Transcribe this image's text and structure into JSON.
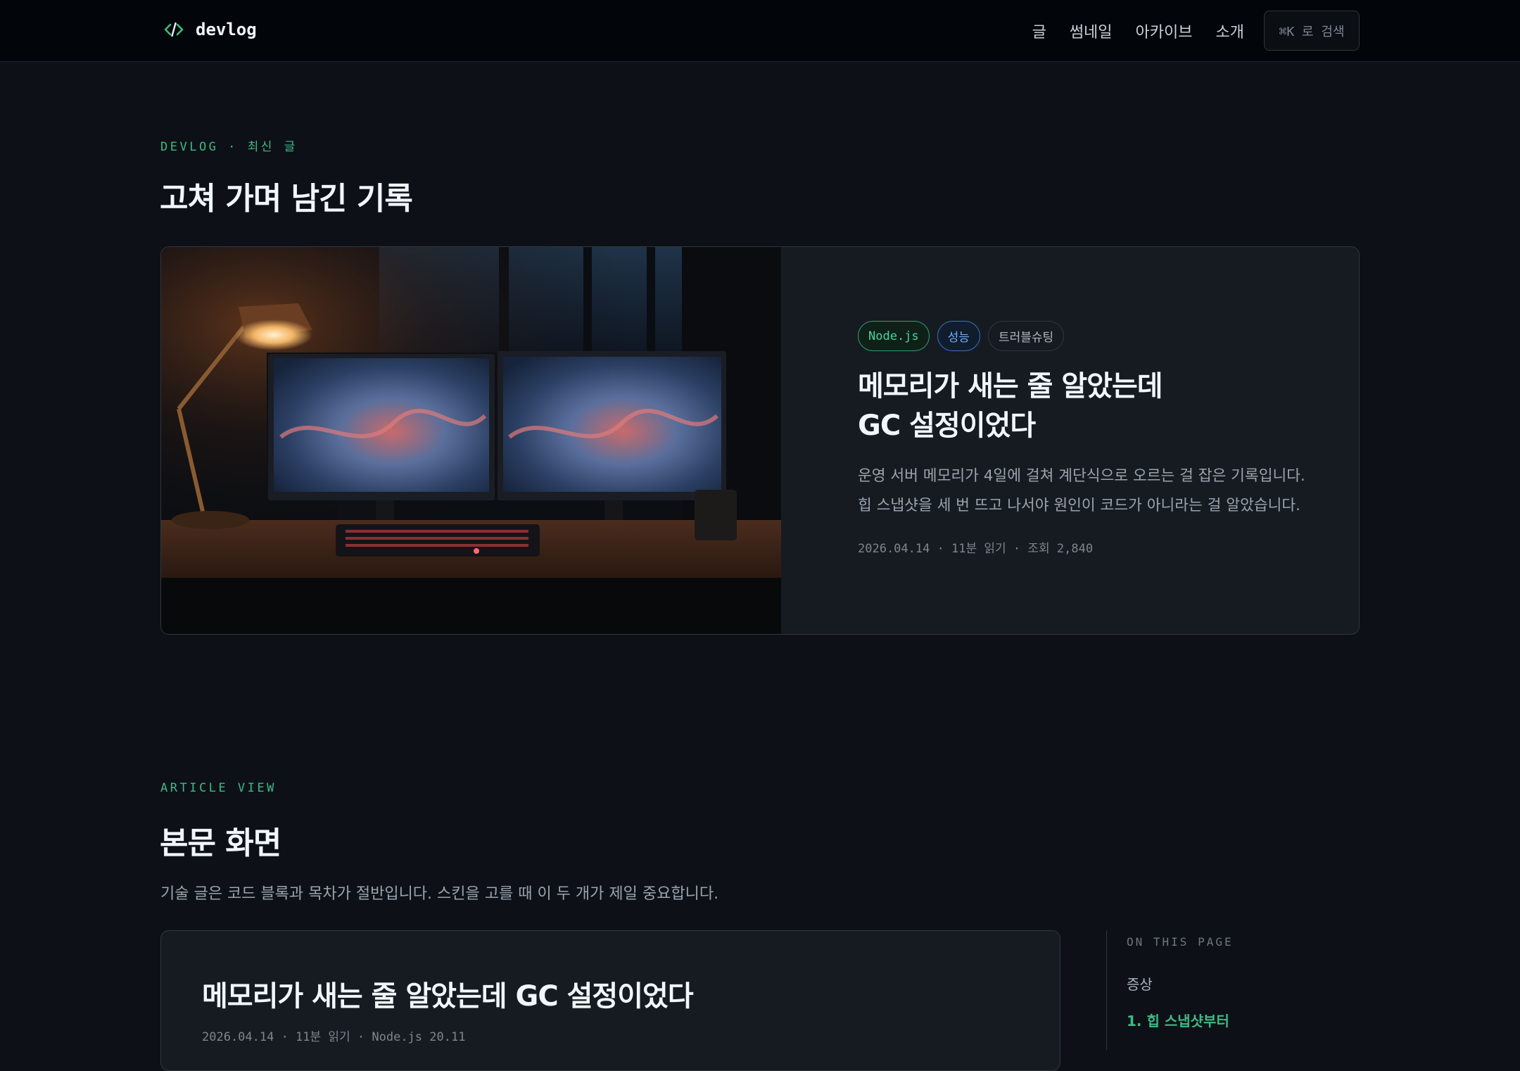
{
  "nav": {
    "brand": "devlog",
    "brand_icon": "code-brackets-icon",
    "links": [
      "글",
      "썸네일",
      "아카이브",
      "소개"
    ],
    "search_label": "⌘K 로 검색"
  },
  "latest": {
    "eyebrow": "DEVLOG · 최신 글",
    "title": "고쳐 가며 남긴 기록",
    "featured": {
      "image": "desk-dual-monitors-lamp-night-photo",
      "tags": [
        "Node.js",
        "성능",
        "트러블슈팅"
      ],
      "title_line1": "메모리가 새는 줄 알았는데",
      "title_line2": "GC 설정이었다",
      "desc_line1": "운영 서버 메모리가 4일에 걸쳐 계단식으로 오르는 걸 잡은 기록입니다.",
      "desc_line2": "힙 스냅샷을 세 번 뜨고 나서야 원인이 코드가 아니라는 걸 알았습니다.",
      "meta": "2026.04.14 · 11분 읽기 · 조회 2,840"
    }
  },
  "article_view": {
    "eyebrow": "ARTICLE VIEW",
    "title": "본문 화면",
    "description": "기술 글은 코드 블록과 목차가 절반입니다. 스킨을 고를 때 이 두 개가 제일 중요합니다.",
    "article": {
      "title": "메모리가 새는 줄 알았는데 GC 설정이었다",
      "meta": "2026.04.14 · 11분 읽기 · Node.js 20.11"
    },
    "toc": {
      "heading": "ON THIS PAGE",
      "items": [
        "증상",
        "1. 힙 스냅샷부터"
      ],
      "active_index": 1
    }
  },
  "colors": {
    "accent": "#3fb984",
    "background": "#0d1117",
    "card": "#161b22",
    "link_blue": "#6cb0ff"
  }
}
